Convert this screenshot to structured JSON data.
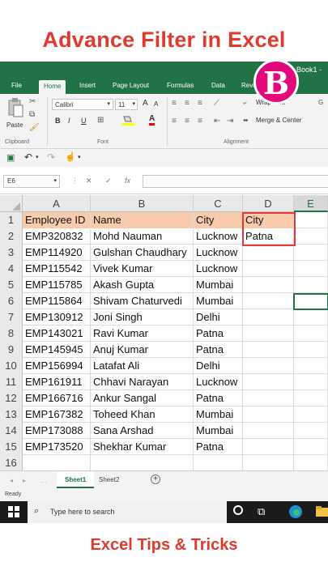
{
  "video_title": "Advance Filter in Excel",
  "footer_title": "Excel Tips & Tricks",
  "logo_letter": "B",
  "window_title": "Book1 -",
  "tabs": [
    "File",
    "Home",
    "Insert",
    "Page Layout",
    "Formulas",
    "Data",
    "Revi"
  ],
  "active_tab": "Home",
  "ribbon": {
    "paste": "Paste",
    "font_name": "Calibri",
    "font_size": "11",
    "bold": "B",
    "italic": "I",
    "underline": "U",
    "wrap_text": "Wrap Text",
    "merge_center": "Merge & Center",
    "clipboard": "Clipboard",
    "font": "Font",
    "alignment": "Alignment",
    "font_grow": "A",
    "font_shrink": "A",
    "font_color": "A"
  },
  "name_box": "E6",
  "fx_label": "fx",
  "columns": [
    "A",
    "B",
    "C",
    "D",
    "E"
  ],
  "rows": [
    {
      "num": "1",
      "a": "Employee ID",
      "b": "Name",
      "c": "City",
      "d": "City"
    },
    {
      "num": "2",
      "a": "EMP320832",
      "b": "Mohd Nauman",
      "c": "Lucknow",
      "d": "Patna"
    },
    {
      "num": "3",
      "a": "EMP114920",
      "b": "Gulshan Chaudhary",
      "c": "Lucknow",
      "d": ""
    },
    {
      "num": "4",
      "a": "EMP115542",
      "b": "Vivek Kumar",
      "c": "Lucknow",
      "d": ""
    },
    {
      "num": "5",
      "a": "EMP115785",
      "b": "Akash Gupta",
      "c": "Mumbai",
      "d": ""
    },
    {
      "num": "6",
      "a": "EMP115864",
      "b": "Shivam Chaturvedi",
      "c": "Mumbai",
      "d": ""
    },
    {
      "num": "7",
      "a": "EMP130912",
      "b": "Joni Singh",
      "c": "Delhi",
      "d": ""
    },
    {
      "num": "8",
      "a": "EMP143021",
      "b": "Ravi Kumar",
      "c": "Patna",
      "d": ""
    },
    {
      "num": "9",
      "a": "EMP145945",
      "b": "Anuj Kumar",
      "c": "Patna",
      "d": ""
    },
    {
      "num": "10",
      "a": "EMP156994",
      "b": "Latafat Ali",
      "c": "Delhi",
      "d": ""
    },
    {
      "num": "11",
      "a": "EMP161911",
      "b": "Chhavi Narayan",
      "c": "Lucknow",
      "d": ""
    },
    {
      "num": "12",
      "a": "EMP166716",
      "b": "Ankur Sangal",
      "c": "Patna",
      "d": ""
    },
    {
      "num": "13",
      "a": "EMP167382",
      "b": "Toheed Khan",
      "c": "Mumbai",
      "d": ""
    },
    {
      "num": "14",
      "a": "EMP173088",
      "b": "Sana Arshad",
      "c": "Mumbai",
      "d": ""
    },
    {
      "num": "15",
      "a": "EMP173520",
      "b": "Shekhar Kumar",
      "c": "Patna",
      "d": ""
    },
    {
      "num": "16",
      "a": "",
      "b": "",
      "c": "",
      "d": ""
    }
  ],
  "sheets": [
    "Sheet1",
    "Sheet2"
  ],
  "active_sheet": "Sheet1",
  "status": "Ready",
  "taskbar_search": "Type here to search",
  "colors": {
    "excel_green": "#217346",
    "header_fill": "#f8cbad",
    "criteria_border": "#e53935",
    "title_red": "#e03a2f",
    "logo_pink": "#e4087d"
  }
}
